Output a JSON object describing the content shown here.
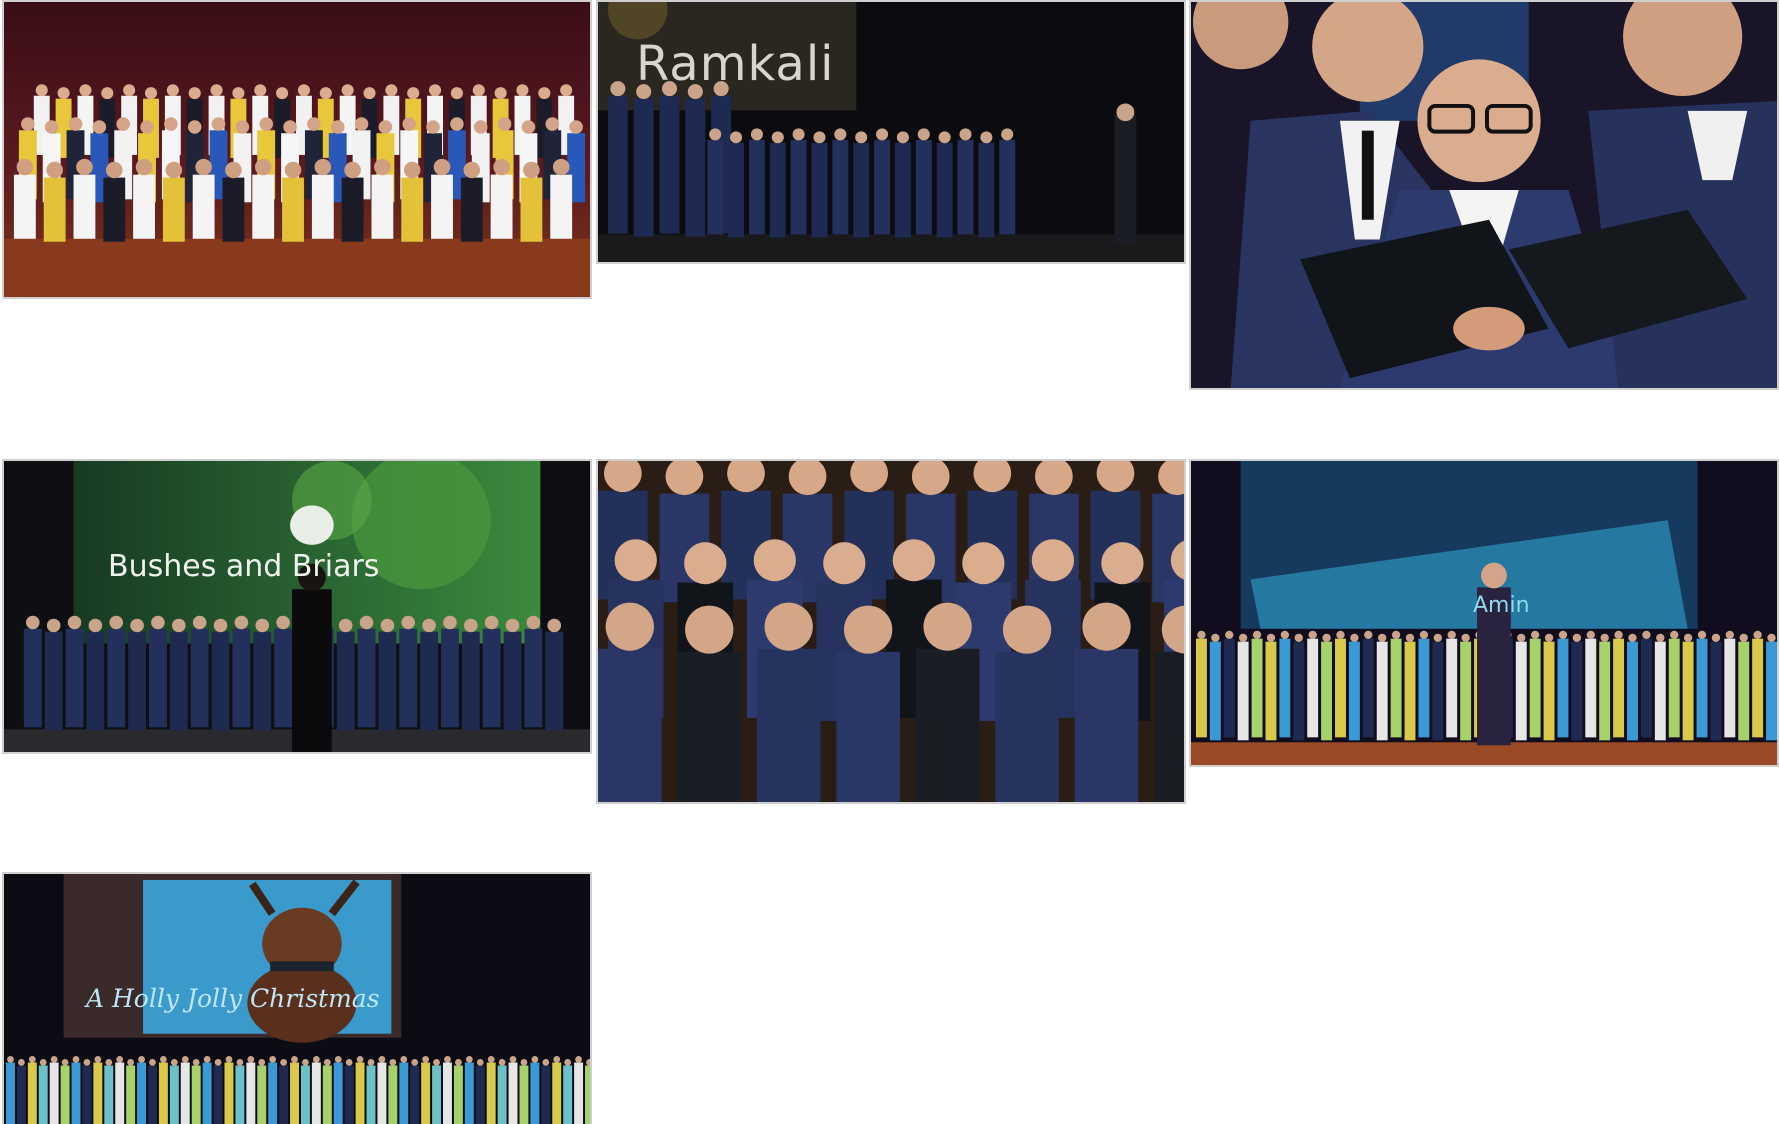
{
  "gallery": {
    "photos": [
      {
        "id": "group-photo",
        "caption": ""
      },
      {
        "id": "ramkali",
        "caption": "Ramkali"
      },
      {
        "id": "closeup-singers",
        "caption": ""
      },
      {
        "id": "bushes-and-briars",
        "caption": "Bushes and Briars"
      },
      {
        "id": "choir-singing",
        "caption": ""
      },
      {
        "id": "amin",
        "caption": "Amin"
      },
      {
        "id": "holly-jolly",
        "caption": "A Holly Jolly Christmas"
      }
    ]
  },
  "colors": {
    "border": "#cfcfcf",
    "background": "#ffffff",
    "stage_dark": "#15101c",
    "uniform_navy": "#23305a",
    "floor_wood": "#8a3a1c",
    "screen_blue": "#2b8fb8",
    "screen_green": "#2e6a3a"
  }
}
